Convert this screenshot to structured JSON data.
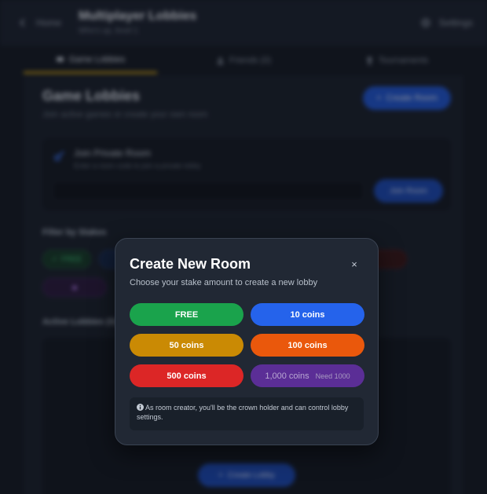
{
  "header": {
    "back_label": "Home",
    "title": "Multiplayer Lobbies",
    "subtitle": "Who's up, level 1",
    "settings_label": "Settings"
  },
  "tabs": [
    {
      "label": "Game Lobbies",
      "icon": "gamepad-icon",
      "active": true
    },
    {
      "label": "Friends (0)",
      "icon": "users-icon",
      "active": false
    },
    {
      "label": "Tournaments",
      "icon": "trophy-icon",
      "active": false
    }
  ],
  "main": {
    "title": "Game Lobbies",
    "subtitle": "Join active games or create your own room",
    "create_room_label": "Create Room",
    "private_room": {
      "title": "Join Private Room",
      "subtitle": "Enter a room code to join a private lobby",
      "join_label": "Join Room"
    },
    "filter_label": "Filter by Stakes",
    "filters": [
      "FREE",
      "10 coins"
    ],
    "active_label": "Active Lobbies (0)",
    "create_lobby_label": "Create Lobby"
  },
  "modal": {
    "title": "Create New Room",
    "close_symbol": "×",
    "subtitle": "Choose your stake amount to create a new lobby",
    "stakes": [
      {
        "label": "FREE",
        "color": "#1aa34c",
        "enabled": true
      },
      {
        "label": "10 coins",
        "color": "#2563eb",
        "enabled": true
      },
      {
        "label": "50 coins",
        "color": "#ca8a04",
        "enabled": true
      },
      {
        "label": "100 coins",
        "color": "#ea580c",
        "enabled": true
      },
      {
        "label": "500 coins",
        "color": "#dc2626",
        "enabled": true
      },
      {
        "label": "1,000 coins",
        "color": "#5b2e96",
        "enabled": false,
        "note": "Need 1000"
      }
    ],
    "info_text": "As room creator, you'll be the crown holder and can control lobby settings."
  },
  "colors": {
    "accent_tab": "#d4a514",
    "primary_button": "#2158d6",
    "modal_bg": "#212834"
  }
}
